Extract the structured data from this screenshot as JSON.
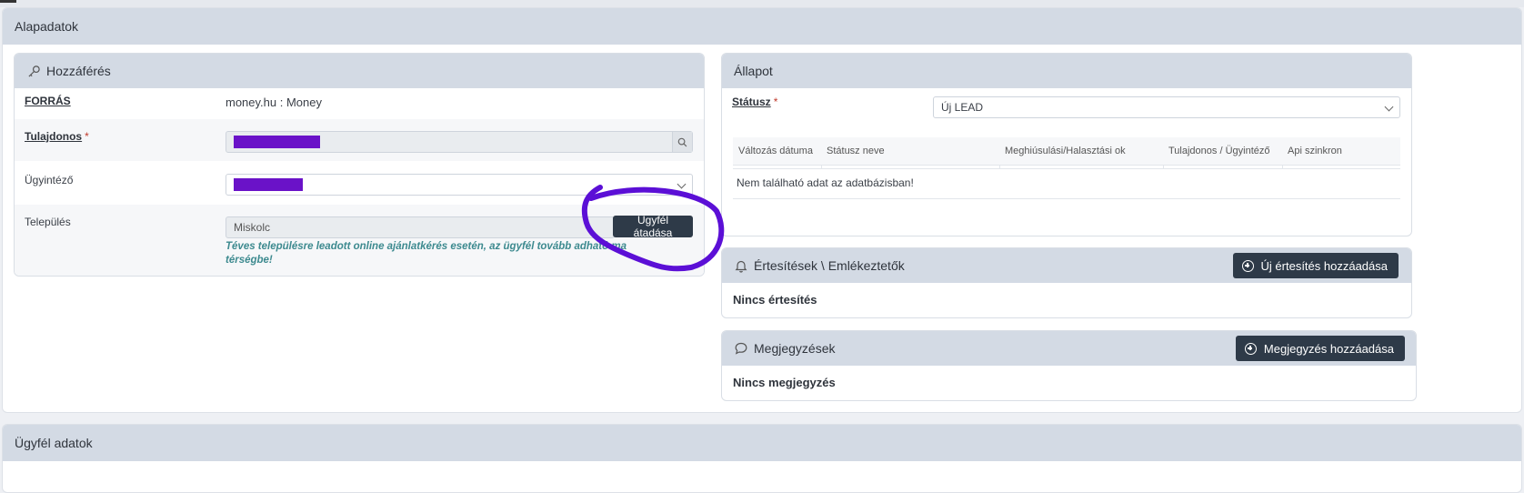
{
  "section_title": "Alapadatok",
  "access": {
    "title": "Hozzáférés",
    "source_label": "FORRÁS",
    "source_value": "money.hu : Money",
    "owner_label": "Tulajdonos",
    "agent_label": "Ügyintéző",
    "city_label": "Település",
    "city_value": "Miskolc",
    "transfer_button": "Ügyfél átadása",
    "hint_line1": "Téves településre leadott online ajánlatkérés esetén, az ügyfél tovább adható ma",
    "hint_line2": "térségbe!"
  },
  "status": {
    "title": "Állapot",
    "status_label": "Státusz",
    "status_value": "Új LEAD",
    "columns": [
      "Változás dátuma",
      "Státusz neve",
      "Meghiúsulási/Halasztási ok",
      "Tulajdonos / Ügyintéző",
      "Api szinkron"
    ],
    "empty_message": "Nem található adat az adatbázisban!"
  },
  "notifications": {
    "title": "Értesítések \\ Emlékeztetők",
    "add_button": "Új értesítés hozzáadása",
    "empty": "Nincs értesítés"
  },
  "notes": {
    "title": "Megjegyzések",
    "add_button": "Megjegyzés hozzáadása",
    "empty": "Nincs megjegyzés"
  },
  "client_section_title": "Ügyfél adatok",
  "colors": {
    "header_bg": "#d3dae4",
    "button_bg": "#2e3a48",
    "redaction": "#6a12c8",
    "annotation": "#5b0fd6",
    "hint": "#3d8a8f"
  }
}
